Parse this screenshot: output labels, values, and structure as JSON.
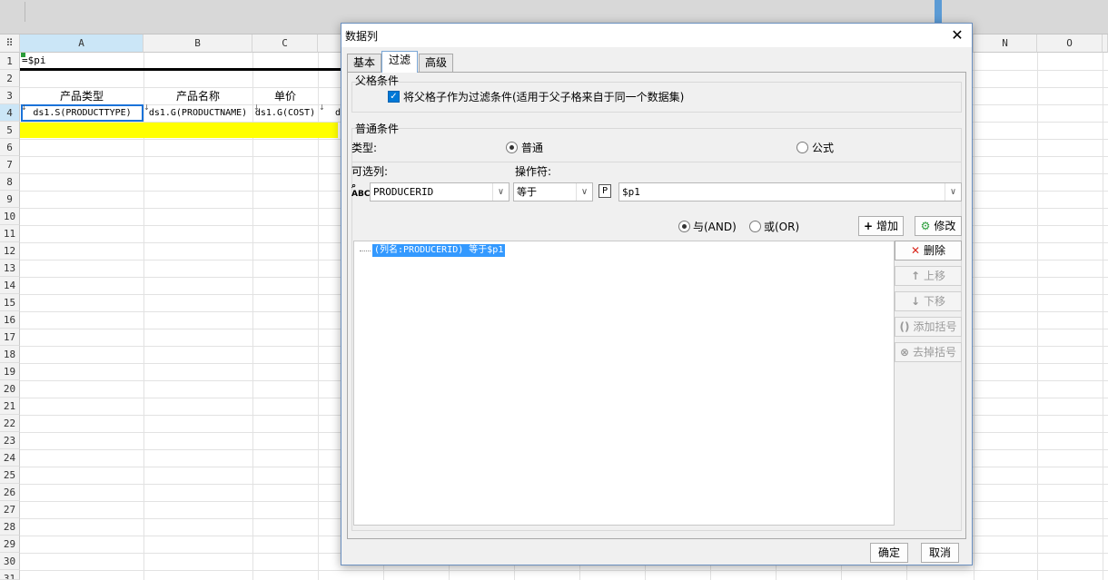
{
  "sheet": {
    "columns": [
      "A",
      "B",
      "C",
      "N",
      "O"
    ],
    "rows": [
      "1",
      "2",
      "3",
      "4",
      "5",
      "6",
      "7",
      "8",
      "9",
      "10",
      "11",
      "12",
      "13",
      "14",
      "15",
      "16",
      "17",
      "18",
      "19",
      "20",
      "21",
      "22",
      "23",
      "24",
      "25",
      "26",
      "27",
      "28",
      "29",
      "30",
      "31"
    ],
    "cells": {
      "a1": "=$pi",
      "a3": "产品类型",
      "b3": "产品名称",
      "c3": "单价",
      "a4": "ds1.S(PRODUCTTYPE)",
      "b4": "ds1.G(PRODUCTNAME)",
      "c4": "ds1.G(COST)",
      "d4": "d"
    },
    "highlight_color": "#ffff00"
  },
  "dialog": {
    "title": "数据列",
    "tabs": [
      "基本",
      "过滤",
      "高级"
    ],
    "active_tab": "过滤",
    "parent_group": {
      "title": "父格条件",
      "checkbox_label": "将父格子作为过滤条件(适用于父子格来自于同一个数据集)",
      "checked": true
    },
    "normal_group": {
      "title": "普通条件",
      "type_label": "类型:",
      "type_normal": "普通",
      "type_formula": "公式",
      "column_label": "可选列:",
      "operator_label": "操作符:",
      "column_value": "PRODUCERID",
      "operator_value": "等于",
      "param_icon": "P",
      "param_value": "$p1",
      "and_label": "与(AND)",
      "or_label": "或(OR)",
      "add_button": "增加",
      "modify_button": "修改",
      "condition_item": "(列名:PRODUCERID) 等于$p1",
      "delete_button": "删除",
      "move_up_button": "上移",
      "move_down_button": "下移",
      "add_bracket_button": "添加括号",
      "remove_bracket_button": "去掉括号"
    },
    "ok_button": "确定",
    "cancel_button": "取消"
  }
}
